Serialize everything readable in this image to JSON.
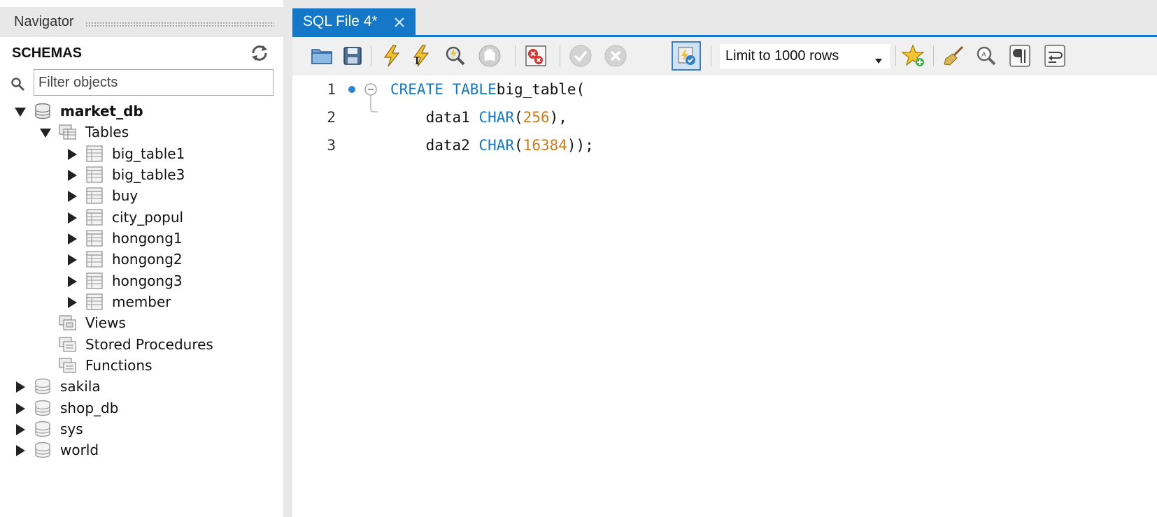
{
  "navigator": {
    "title": "Navigator",
    "schemas_label": "SCHEMAS",
    "filter_placeholder": "Filter objects",
    "tree": {
      "db": "market_db",
      "tables_label": "Tables",
      "tables": [
        "big_table1",
        "big_table3",
        "buy",
        "city_popul",
        "hongong1",
        "hongong2",
        "hongong3",
        "member"
      ],
      "views_label": "Views",
      "procedures_label": "Stored Procedures",
      "functions_label": "Functions",
      "other_schemas": [
        "sakila",
        "shop_db",
        "sys",
        "world"
      ]
    }
  },
  "editor": {
    "tab_label": "SQL File 4*",
    "limit_value": "Limit to 1000 rows",
    "lines": [
      {
        "no": "1",
        "tokens": [
          [
            "kw",
            "CREATE TABLE"
          ],
          [
            "",
            "big_table("
          ]
        ]
      },
      {
        "no": "2",
        "tokens": [
          [
            "",
            "    data1 "
          ],
          [
            "kw",
            "CHAR"
          ],
          [
            "",
            "("
          ],
          [
            "num",
            "256"
          ],
          [
            "",
            "),"
          ]
        ]
      },
      {
        "no": "3",
        "tokens": [
          [
            "",
            "    data2 "
          ],
          [
            "kw",
            "CHAR"
          ],
          [
            "",
            "("
          ],
          [
            "num",
            "16384"
          ],
          [
            "",
            "));"
          ]
        ]
      }
    ]
  },
  "colors": {
    "accent": "#1577c7",
    "keyword": "#1577c7",
    "number": "#d17a16"
  }
}
